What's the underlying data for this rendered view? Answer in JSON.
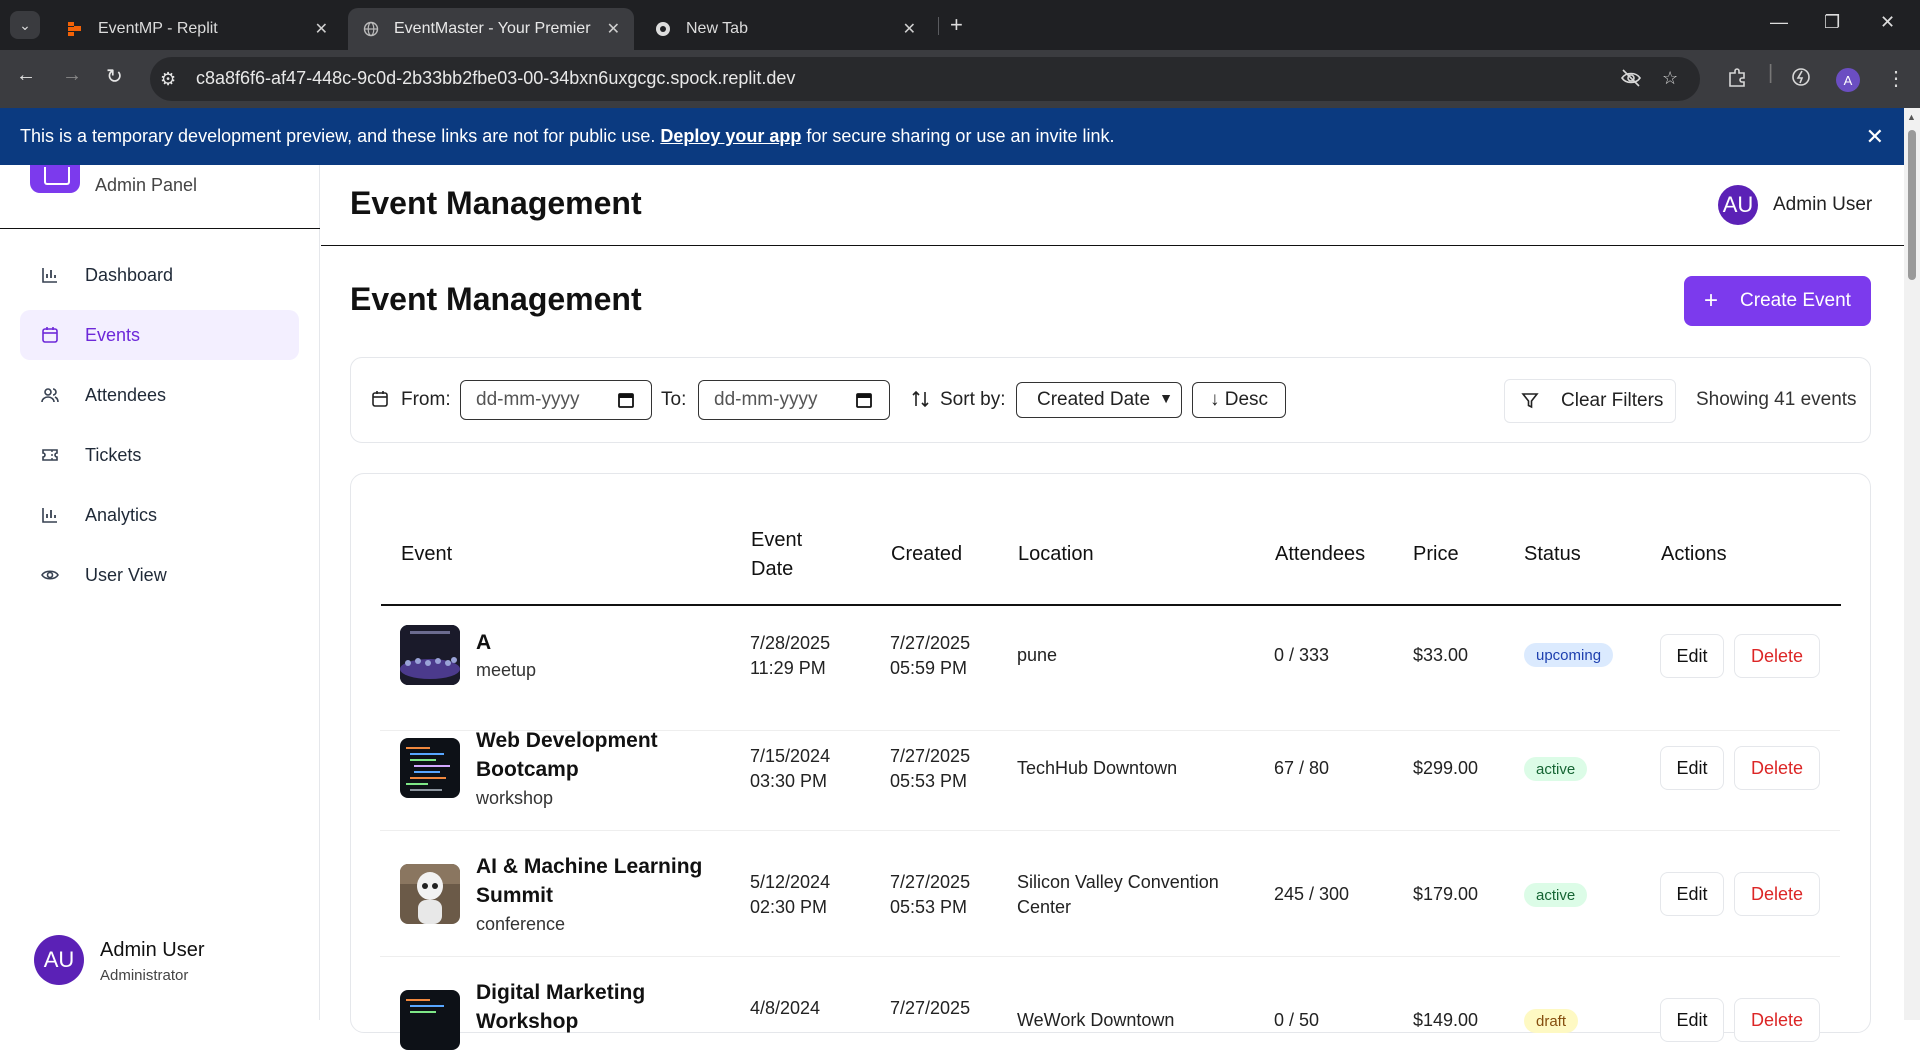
{
  "browser": {
    "tabs": [
      {
        "title": "EventMP - Replit"
      },
      {
        "title": "EventMaster - Your Premier Eve"
      },
      {
        "title": "New Tab"
      }
    ],
    "url": "c8a8f6f6-af47-448c-9c0d-2b33bb2fbe03-00-34bxn6uxgcgc.spock.replit.dev",
    "profile_initial": "A"
  },
  "banner": {
    "text_before": "This is a temporary development preview, and these links are not for public use.",
    "link": "Deploy your app",
    "text_after": "for secure sharing or use an invite link."
  },
  "sidebar": {
    "subtitle": "Admin Panel",
    "items": [
      {
        "label": "Dashboard",
        "icon": "bar-chart-icon"
      },
      {
        "label": "Events",
        "icon": "calendar-icon"
      },
      {
        "label": "Attendees",
        "icon": "users-icon"
      },
      {
        "label": "Tickets",
        "icon": "ticket-icon"
      },
      {
        "label": "Analytics",
        "icon": "bar-chart-icon"
      },
      {
        "label": "User View",
        "icon": "eye-icon"
      }
    ],
    "active": "Events",
    "user": {
      "initials": "AU",
      "name": "Admin User",
      "role": "Administrator"
    }
  },
  "header": {
    "title": "Event Management",
    "user_initials": "AU",
    "user_name": "Admin User"
  },
  "main": {
    "title": "Event Management",
    "create_label": "Create Event"
  },
  "filters": {
    "from_label": "From:",
    "from_placeholder": "dd-mm-yyyy",
    "to_label": "To:",
    "to_placeholder": "dd-mm-yyyy",
    "sort_label": "Sort by:",
    "sort_value": "Created Date",
    "order_label": "↓ Desc",
    "clear_label": "Clear Filters",
    "showing": "Showing 41 events"
  },
  "table": {
    "headers": {
      "event": "Event",
      "event_date_1": "Event",
      "event_date_2": "Date",
      "created": "Created",
      "location": "Location",
      "attendees": "Attendees",
      "price": "Price",
      "status": "Status",
      "actions": "Actions"
    },
    "edit_label": "Edit",
    "delete_label": "Delete",
    "rows": [
      {
        "name": "A",
        "category": "meetup",
        "date": "7/28/2025",
        "time": "11:29 PM",
        "created_date": "7/27/2025",
        "created_time": "05:59 PM",
        "location_1": "pune",
        "location_2": "",
        "attendees": "0 / 333",
        "price": "$33.00",
        "status": "upcoming"
      },
      {
        "name_1": "Web Development",
        "name_2": "Bootcamp",
        "category": "workshop",
        "date": "7/15/2024",
        "time": "03:30 PM",
        "created_date": "7/27/2025",
        "created_time": "05:53 PM",
        "location_1": "TechHub Downtown",
        "location_2": "",
        "attendees": "67 / 80",
        "price": "$299.00",
        "status": "active"
      },
      {
        "name_1": "AI & Machine Learning",
        "name_2": "Summit",
        "category": "conference",
        "date": "5/12/2024",
        "time": "02:30 PM",
        "created_date": "7/27/2025",
        "created_time": "05:53 PM",
        "location_1": "Silicon Valley Convention",
        "location_2": "Center",
        "attendees": "245 / 300",
        "price": "$179.00",
        "status": "active"
      },
      {
        "name_1": "Digital Marketing",
        "name_2": "Workshop",
        "category": "",
        "date": "4/8/2024",
        "time": "",
        "created_date": "7/27/2025",
        "created_time": "",
        "location_1": "WeWork Downtown",
        "location_2": "",
        "attendees": "0 / 50",
        "price": "$149.00",
        "status": "draft"
      }
    ]
  },
  "colors": {
    "accent": "#7c3aed",
    "banner": "#0b3a80",
    "delete": "#dc2626"
  }
}
